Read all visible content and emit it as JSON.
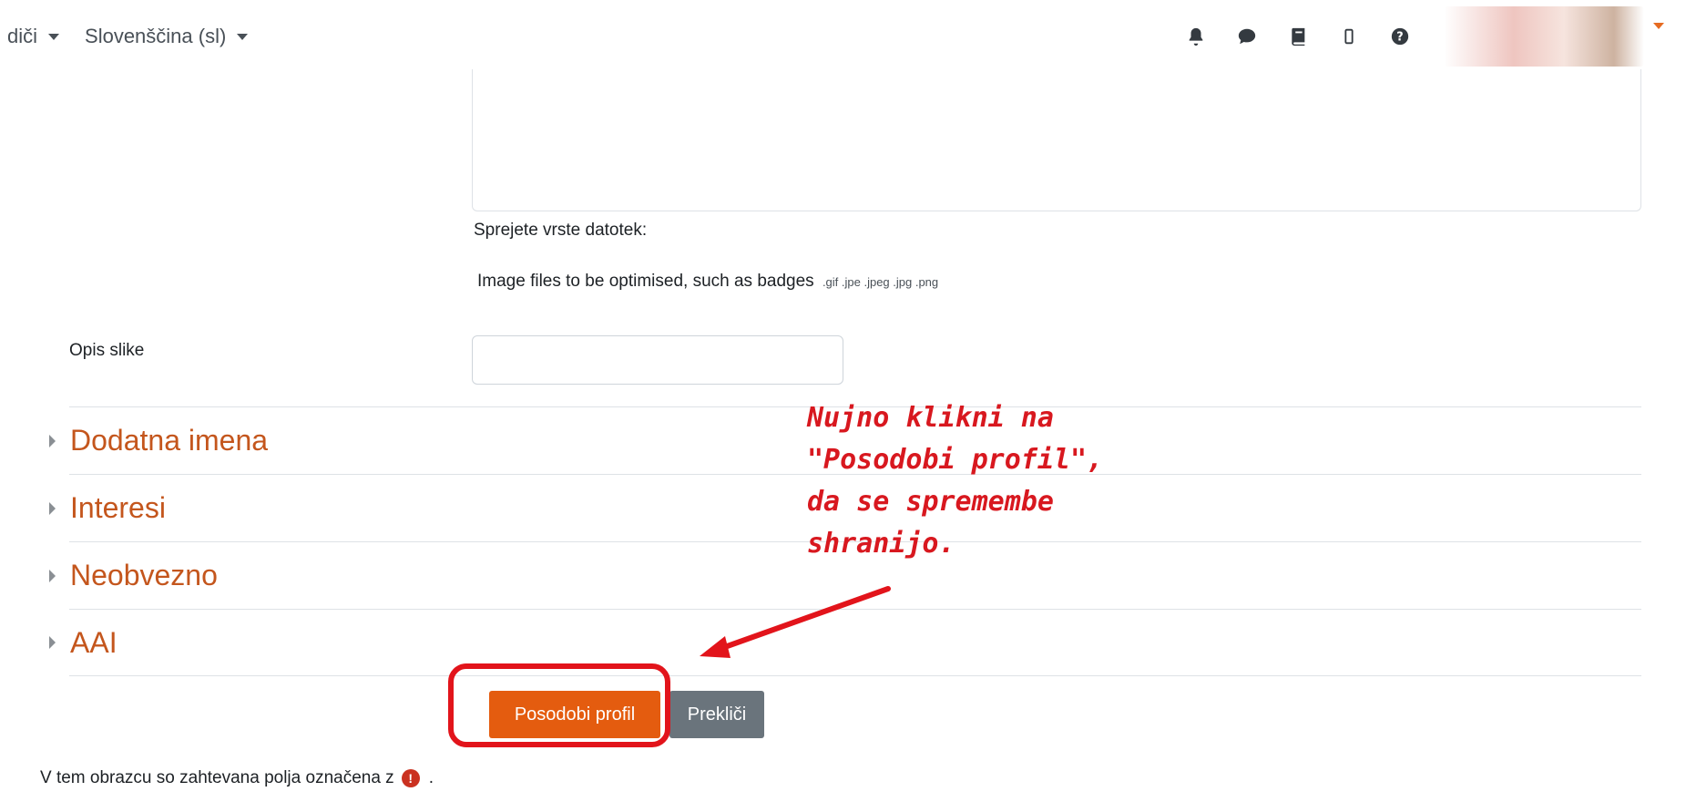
{
  "navbar": {
    "menu_partial": "diči",
    "language": "Slovenščina (sl)",
    "icons": [
      "bell-icon",
      "chat-bubble-icon",
      "book-icon",
      "mobile-phone-icon",
      "question-circle-icon"
    ]
  },
  "filepicker": {
    "accepted_label": "Sprejete vrste datotek:",
    "accepted_types_text": "Image files to be optimised, such as badges",
    "accepted_extensions": ".gif .jpe .jpeg .jpg .png"
  },
  "image_description": {
    "label": "Opis slike",
    "value": ""
  },
  "sections": [
    {
      "title": "Dodatna imena"
    },
    {
      "title": "Interesi"
    },
    {
      "title": "Neobvezno"
    },
    {
      "title": "AAI"
    }
  ],
  "buttons": {
    "submit": "Posodobi profil",
    "cancel": "Prekliči"
  },
  "required_note": {
    "text": "V tem obrazcu so zahtevana polja označena z",
    "icon_glyph": "!",
    "suffix": "."
  },
  "annotation": {
    "lines": [
      "Nujno klikni na",
      "\"Posodobi profil\",",
      "da se spremembe",
      "shranijo."
    ]
  },
  "colors": {
    "accent": "#e45c0f",
    "section_title": "#c4561d",
    "annotation_red": "#d8181f",
    "secondary_button": "#6a747c"
  }
}
